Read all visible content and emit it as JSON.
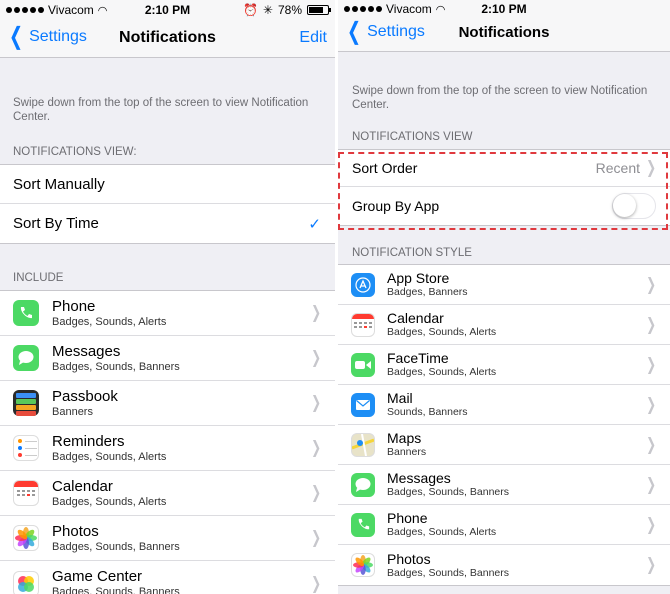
{
  "left": {
    "status": {
      "carrier": "Vivacom",
      "time": "2:10 PM",
      "battery": "78%",
      "battery_level": 0.78
    },
    "nav": {
      "back": "Settings",
      "title": "Notifications",
      "edit": "Edit"
    },
    "info": "Swipe down from the top of the screen to view Notification Center.",
    "view_header": "NOTIFICATIONS VIEW:",
    "view_options": [
      "Sort Manually",
      "Sort By Time"
    ],
    "selected_view": "Sort By Time",
    "include_header": "INCLUDE",
    "apps": [
      {
        "name": "Phone",
        "sub": "Badges, Sounds, Alerts",
        "icon": "phone-icon"
      },
      {
        "name": "Messages",
        "sub": "Badges, Sounds, Banners",
        "icon": "messages-icon"
      },
      {
        "name": "Passbook",
        "sub": "Banners",
        "icon": "passbook-icon"
      },
      {
        "name": "Reminders",
        "sub": "Badges, Sounds, Alerts",
        "icon": "reminders-icon"
      },
      {
        "name": "Calendar",
        "sub": "Badges, Sounds, Alerts",
        "icon": "calendar-icon"
      },
      {
        "name": "Photos",
        "sub": "Badges, Sounds, Banners",
        "icon": "photos-icon"
      },
      {
        "name": "Game Center",
        "sub": "Badges, Sounds, Banners",
        "icon": "game-center-icon"
      }
    ]
  },
  "right": {
    "status": {
      "carrier": "Vivacom",
      "time": "2:10 PM"
    },
    "nav": {
      "back": "Settings",
      "title": "Notifications"
    },
    "info": "Swipe down from the top of the screen to view Notification Center.",
    "view_header": "NOTIFICATIONS VIEW",
    "sort_order": {
      "label": "Sort Order",
      "value": "Recent"
    },
    "group_by_app": {
      "label": "Group By App",
      "on": false
    },
    "style_header": "NOTIFICATION STYLE",
    "apps": [
      {
        "name": "App Store",
        "sub": "Badges, Banners",
        "icon": "app-store-icon"
      },
      {
        "name": "Calendar",
        "sub": "Badges, Sounds, Alerts",
        "icon": "calendar-icon"
      },
      {
        "name": "FaceTime",
        "sub": "Badges, Sounds, Alerts",
        "icon": "facetime-icon"
      },
      {
        "name": "Mail",
        "sub": "Sounds, Banners",
        "icon": "mail-icon"
      },
      {
        "name": "Maps",
        "sub": "Banners",
        "icon": "maps-icon"
      },
      {
        "name": "Messages",
        "sub": "Badges, Sounds, Banners",
        "icon": "messages-icon"
      },
      {
        "name": "Phone",
        "sub": "Badges, Sounds, Alerts",
        "icon": "phone-icon"
      },
      {
        "name": "Photos",
        "sub": "Badges, Sounds, Banners",
        "icon": "photos-icon"
      }
    ]
  },
  "colors": {
    "accent": "#0a7aff",
    "highlight": "#e0393e",
    "background": "#efeff4"
  }
}
